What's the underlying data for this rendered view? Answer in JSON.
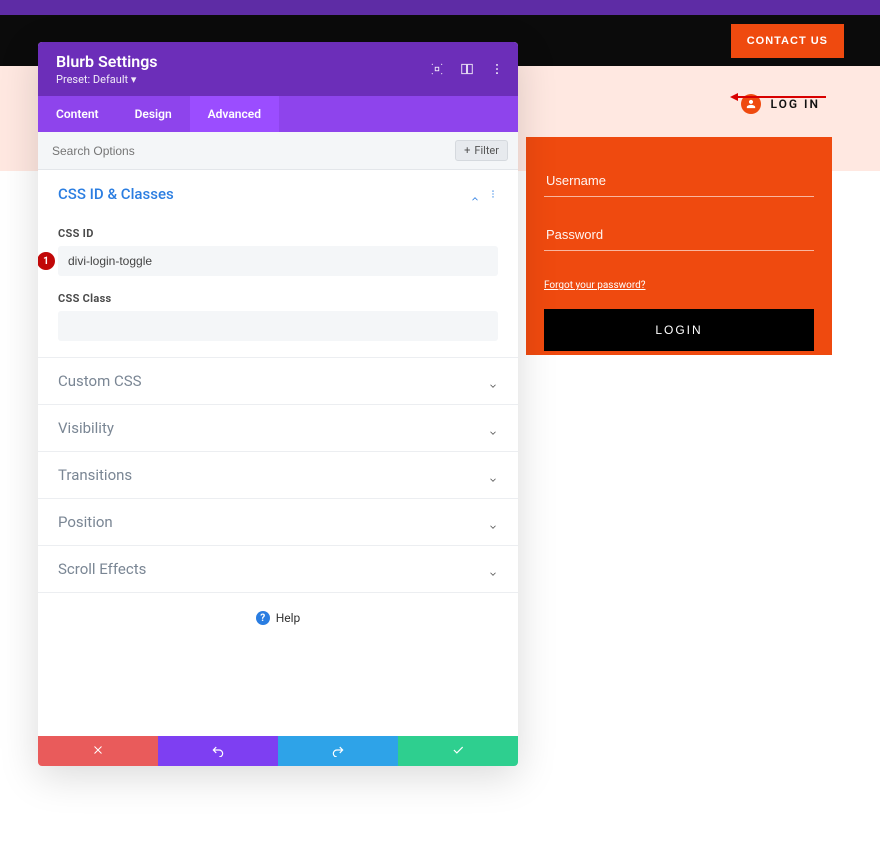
{
  "topbar": {
    "contact_label": "CONTACT US"
  },
  "login_trigger": {
    "label": "LOG IN"
  },
  "login_form": {
    "username_placeholder": "Username",
    "password_placeholder": "Password",
    "forgot_label": "Forgot your password?",
    "submit_label": "LOGIN"
  },
  "settings": {
    "title": "Blurb Settings",
    "preset_label": "Preset: Default",
    "tabs": {
      "content": "Content",
      "design": "Design",
      "advanced": "Advanced"
    },
    "search_placeholder": "Search Options",
    "filter_label": "Filter",
    "sections": {
      "css_id_classes": {
        "title": "CSS ID & Classes",
        "css_id_label": "CSS ID",
        "css_id_value": "divi-login-toggle",
        "css_class_label": "CSS Class",
        "css_class_value": ""
      },
      "custom_css": "Custom CSS",
      "visibility": "Visibility",
      "transitions": "Transitions",
      "position": "Position",
      "scroll_effects": "Scroll Effects"
    },
    "badge_number": "1",
    "help_label": "Help"
  }
}
